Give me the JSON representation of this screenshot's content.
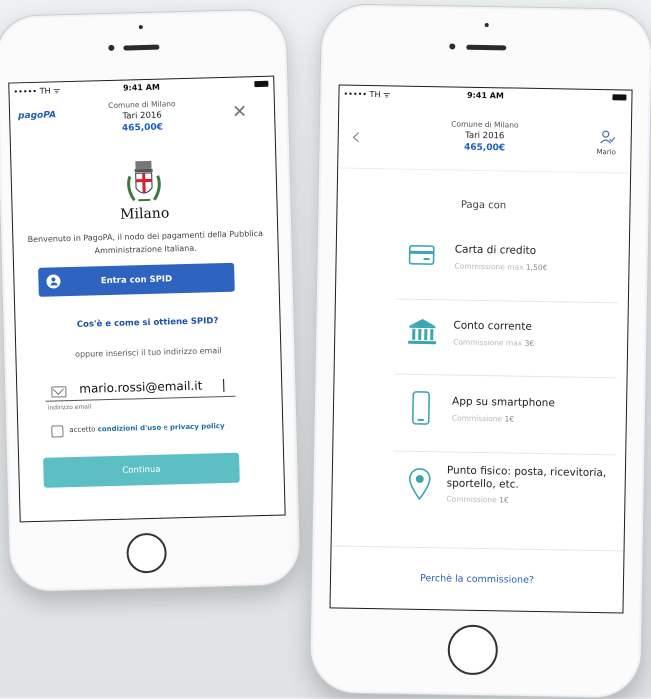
{
  "status_bar": {
    "carrier": "••••• TH ᯤ",
    "time": "9:41 AM"
  },
  "left_screen": {
    "logo": "pagoPA",
    "org": "Comune di Milano",
    "title": "Tari 2016",
    "amount": "465,00€",
    "city_name": "Milano",
    "welcome_text": "Benvenuto in PagoPA, il nodo dei pagamenti della Pubblica Amministrazione Italiana.",
    "spid_button": "Entra con SPID",
    "spid_info_link": "Cos'è e come si ottiene SPID?",
    "email_prompt": "oppure inserisci il tuo indirizzo email",
    "email_value": "mario.rossi@email.it",
    "email_label": "indirizzo email",
    "terms_prefix": "accetto ",
    "terms_link1": "condizioni d'uso",
    "terms_mid": " e ",
    "terms_link2": "privacy policy",
    "continue_button": "Continua"
  },
  "right_screen": {
    "org": "Comune di Milano",
    "title": "Tari 2016",
    "amount": "465,00€",
    "user_name": "Mario",
    "paga_con": "Paga con",
    "methods": [
      {
        "title": "Carta di credito",
        "sub_label": "Commissione max ",
        "fee": "1,50€",
        "icon": "credit-card-icon"
      },
      {
        "title": "Conto corrente",
        "sub_label": "Commissione max ",
        "fee": "3€",
        "icon": "bank-icon"
      },
      {
        "title": "App su smartphone",
        "sub_label": "Commissione ",
        "fee": "1€",
        "icon": "smartphone-icon"
      },
      {
        "title": "Punto fisico: posta, ricevitoria, sportello, etc.",
        "sub_label": "Commissione ",
        "fee": "1€",
        "icon": "location-pin-icon"
      }
    ],
    "footer_link": "Perchè la commissione?"
  },
  "colors": {
    "accent_blue": "#2f63c0",
    "teal": "#5cbfc3",
    "icon_teal": "#3aa6b3"
  }
}
